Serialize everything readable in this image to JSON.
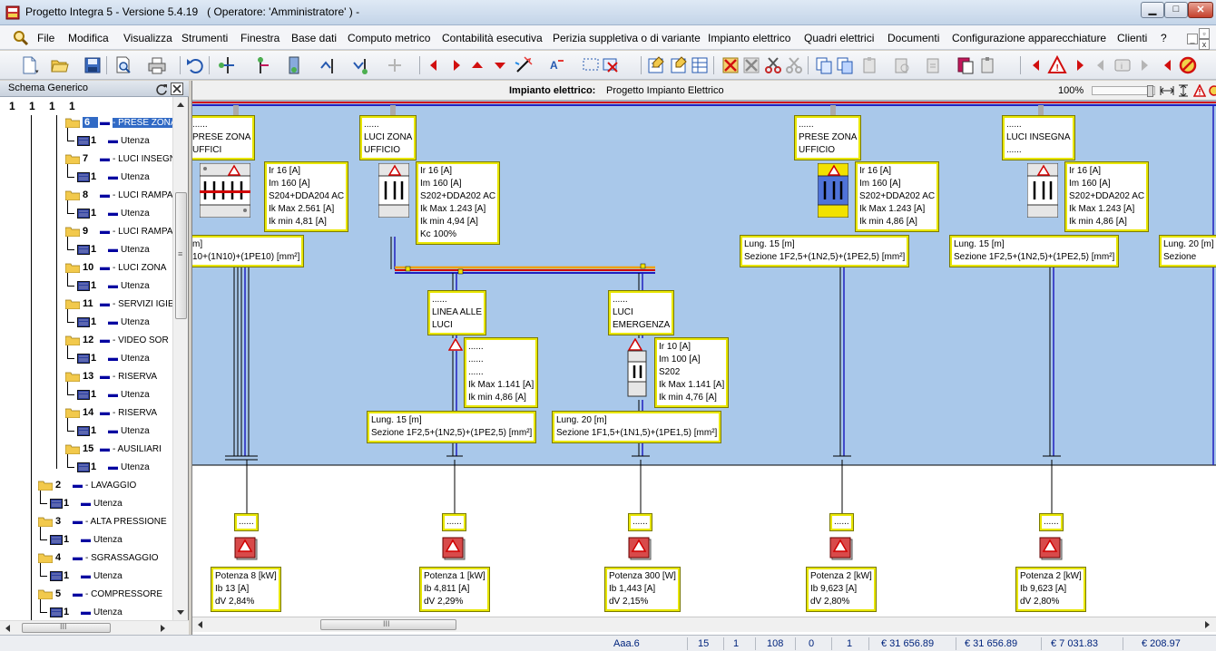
{
  "window": {
    "title_prefix": "Progetto Integra 5  -  Versione 5.4.19",
    "title_operator": "( Operatore: 'Amministratore' ) -",
    "min_glyph": "▁",
    "max_glyph": "□",
    "close_glyph": "✕"
  },
  "menu": {
    "items": [
      "File",
      "Modifica",
      "Visualizza",
      "Strumenti",
      "Finestra",
      "Base dati",
      "Computo metrico",
      "Contabilità esecutiva",
      "Perizia suppletiva o di variante",
      "Impianto elettrico",
      "Quadri elettrici",
      "Documenti",
      "Configurazione apparecchiature",
      "Clienti",
      "?"
    ],
    "mdi_min": "_",
    "mdi_restore": "▫",
    "mdi_close": "x"
  },
  "sidebar": {
    "title": "Schema Generico",
    "root": "1 1 1 1",
    "nodes": [
      {
        "num": "6",
        "label": "- PRESE ZONA",
        "selected": true
      },
      {
        "num": "1",
        "label": "Utenza"
      },
      {
        "num": "7",
        "label": "- LUCI INSEGNA"
      },
      {
        "num": "1",
        "label": "Utenza"
      },
      {
        "num": "8",
        "label": "- LUCI RAMPA"
      },
      {
        "num": "1",
        "label": "Utenza"
      },
      {
        "num": "9",
        "label": "- LUCI RAMPA"
      },
      {
        "num": "1",
        "label": "Utenza"
      },
      {
        "num": "10",
        "label": "- LUCI ZONA"
      },
      {
        "num": "1",
        "label": "Utenza"
      },
      {
        "num": "11",
        "label": "- SERVIZI IGIE"
      },
      {
        "num": "1",
        "label": "Utenza"
      },
      {
        "num": "12",
        "label": "- VIDEO  SOR"
      },
      {
        "num": "1",
        "label": "Utenza"
      },
      {
        "num": "13",
        "label": "- RISERVA"
      },
      {
        "num": "1",
        "label": "Utenza"
      },
      {
        "num": "14",
        "label": "- RISERVA"
      },
      {
        "num": "1",
        "label": "Utenza"
      },
      {
        "num": "15",
        "label": "- AUSILIARI"
      },
      {
        "num": "1",
        "label": "Utenza"
      },
      {
        "num": "2",
        "label": "- LAVAGGIO"
      },
      {
        "num": "1",
        "label": "Utenza"
      },
      {
        "num": "3",
        "label": "- ALTA  PRESSIONE"
      },
      {
        "num": "1",
        "label": "Utenza"
      },
      {
        "num": "4",
        "label": "- SGRASSAGGIO"
      },
      {
        "num": "1",
        "label": "Utenza"
      },
      {
        "num": "5",
        "label": "- COMPRESSORE"
      },
      {
        "num": "1",
        "label": "Utenza"
      }
    ],
    "hscroll_grip": "III",
    "vscroll_grip": "≡"
  },
  "canvas": {
    "title_bold": "Impianto elettrico:",
    "title": "Progetto Impianto Elettrico",
    "zoom": "100%",
    "hscroll_grip": "III"
  },
  "diagram": {
    "name_boxes": [
      {
        "lines": [
          "......",
          "PRESE ZONA",
          "UFFICI"
        ]
      },
      {
        "lines": [
          "......",
          "LUCI ZONA",
          "UFFICIO"
        ]
      },
      {
        "lines": [
          "......",
          "PRESE ZONA",
          "UFFICIO"
        ]
      },
      {
        "lines": [
          "......",
          "LUCI INSEGNA",
          "......"
        ]
      },
      {
        "lines": [
          "......",
          "LINEA ALLE",
          "LUCI"
        ]
      },
      {
        "lines": [
          "......",
          "LUCI",
          "EMERGENZA"
        ]
      }
    ],
    "protection_boxes": [
      {
        "lines": [
          "Ir  16 [A]",
          "Im 160 [A]",
          "S204+DDA204 AC",
          "Ik Max 2.561 [A]",
          "Ik min 4,81 [A]"
        ]
      },
      {
        "lines": [
          "Ir  16 [A]",
          "Im 160 [A]",
          "S202+DDA202 AC",
          "Ik Max 1.243 [A]",
          "Ik min 4,94 [A]",
          "Kc 100%"
        ]
      },
      {
        "lines": [
          "Ir  16 [A]",
          "Im 160 [A]",
          "S202+DDA202 AC",
          "Ik Max 1.243 [A]",
          "Ik min 4,86 [A]"
        ]
      },
      {
        "lines": [
          "Ir  16 [A]",
          "Im 160 [A]",
          "S202+DDA202 AC",
          "Ik Max 1.243 [A]",
          "Ik min 4,86 [A]"
        ]
      },
      {
        "lines": [
          "......",
          "......",
          "......",
          "Ik Max 1.141 [A]",
          "Ik min 4,86 [A]"
        ]
      },
      {
        "lines": [
          "Ir  10 [A]",
          "Im 100 [A]",
          "S202",
          "Ik Max 1.141 [A]",
          "Ik min 4,76 [A]"
        ]
      }
    ],
    "cable_boxes": [
      {
        "lines": [
          "m]",
          "10+(1N10)+(1PE10) [mm²]"
        ]
      },
      {
        "lines": [
          "Lung. 15 [m]",
          "Sezione 1F2,5+(1N2,5)+(1PE2,5) [mm²]"
        ]
      },
      {
        "lines": [
          "Lung. 15 [m]",
          "Sezione 1F2,5+(1N2,5)+(1PE2,5) [mm²]"
        ]
      },
      {
        "lines": [
          "Lung. 20 [m]",
          "Sezione"
        ]
      },
      {
        "lines": [
          "Lung. 15 [m]",
          "Sezione 1F2,5+(1N2,5)+(1PE2,5) [mm²]"
        ]
      },
      {
        "lines": [
          "Lung. 20 [m]",
          "Sezione 1F1,5+(1N1,5)+(1PE1,5) [mm²]"
        ]
      }
    ],
    "load_labels": [
      "......",
      "......",
      "......",
      "......",
      "......"
    ],
    "load_boxes": [
      {
        "lines": [
          "Potenza 8 [kW]",
          "Ib 13 [A]",
          "dV 2,84%"
        ]
      },
      {
        "lines": [
          "Potenza 1 [kW]",
          "Ib 4,811 [A]",
          "dV 2,29%"
        ]
      },
      {
        "lines": [
          "Potenza 300 [W]",
          "Ib 1,443 [A]",
          "dV 2,15%"
        ]
      },
      {
        "lines": [
          "Potenza 2 [kW]",
          "Ib 9,623 [A]",
          "dV 2,80%"
        ]
      },
      {
        "lines": [
          "Potenza 2 [kW]",
          "Ib 9,623 [A]",
          "dV 2,80%"
        ]
      }
    ]
  },
  "status": {
    "fields": [
      "Aaa.6",
      "15",
      "1",
      "108",
      "0",
      "1",
      "€ 31 656.89",
      "€ 31 656.89",
      "€ 7 031.83",
      "€ 208.97"
    ]
  },
  "colors": {
    "panel_blue": "#a9c8ea",
    "box_border": "#e8e600",
    "bus_orange": "#f0a000",
    "bus_red": "#d00000",
    "bus_blue": "#2020c0",
    "warning_red": "#e00000",
    "status_text": "#00247d"
  }
}
